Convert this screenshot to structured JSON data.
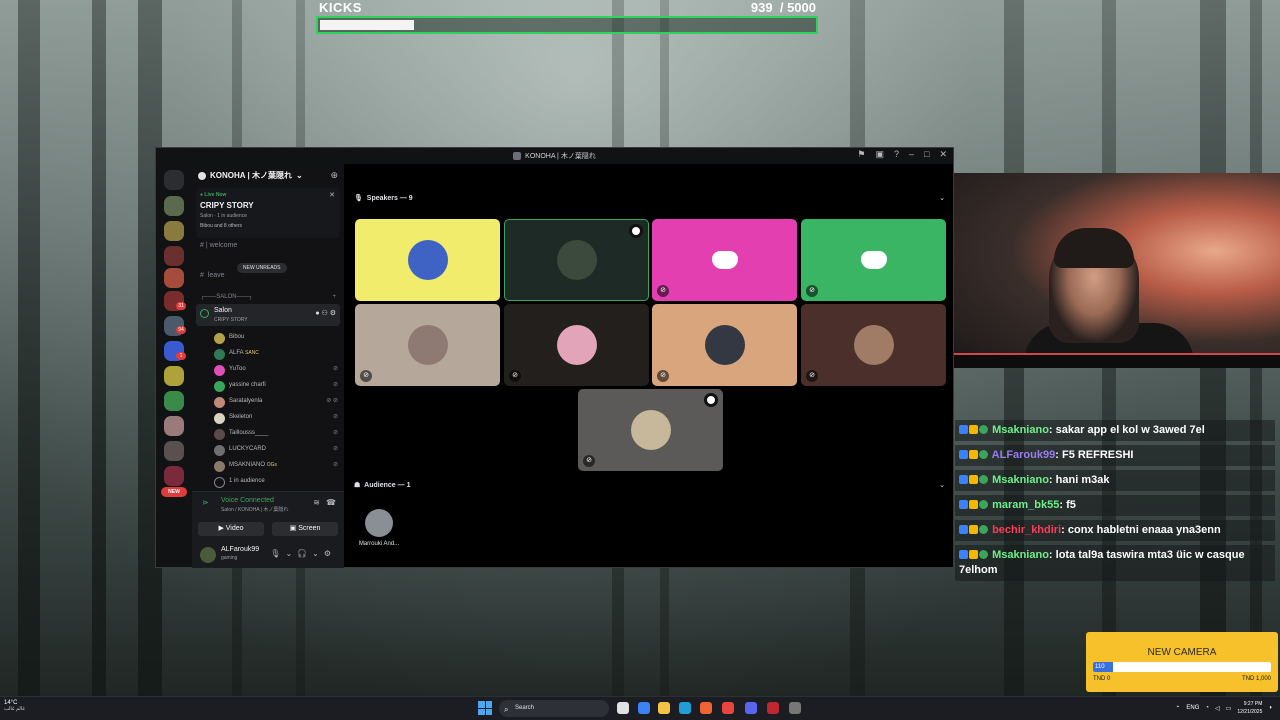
{
  "overlay": {
    "kicks_label": "KICKS",
    "kicks_count": "939",
    "kicks_goal": "/ 5000",
    "kicks_progress": 0.188
  },
  "discord": {
    "window_title": "KONOHA | 木ノ葉隠れ",
    "guild_name": "KONOHA | 木ノ葉隠れ",
    "live": {
      "badge": "Live Now",
      "stage_title": "CRIPY STORY",
      "subtitle": "Salon · 1 in audience",
      "participants": "Bibou and 8 others"
    },
    "channels": [
      "welcome",
      "leave"
    ],
    "new_unreads": "NEW UNREADS",
    "category": "SALON",
    "active_channel": {
      "name": "Salon",
      "topic": "CRIPY STORY"
    },
    "voice_users": [
      {
        "name": "Bibou",
        "color": "#b3a24a"
      },
      {
        "name": "ALFA",
        "tag": "SANC",
        "color": "#2f7a55"
      },
      {
        "name": "YuToo",
        "color": "#e04fb8"
      },
      {
        "name": "yassine charfi",
        "color": "#3ba55c"
      },
      {
        "name": "Saratalyenla",
        "color": "#c08a7a"
      },
      {
        "name": "Skeleton",
        "color": "#d8d3c2"
      },
      {
        "name": "Taillousss____",
        "color": "#5a4a48"
      },
      {
        "name": "LUCKYCARD",
        "color": "#6e6e6e"
      },
      {
        "name": "MSAKNIANO",
        "tag": "OGs",
        "color": "#8a7a6a"
      },
      {
        "name": "1 in audience",
        "color": "#1a1b1e"
      }
    ],
    "voice": {
      "status": "Voice Connected",
      "location": "Salon / KONOHA | 木ノ葉隠れ",
      "video_label": "Video",
      "screen_label": "Screen"
    },
    "user": {
      "name": "ALFarouk99",
      "status": "gaming"
    },
    "speakers_header": "Speakers — 9",
    "audience_header": "Audience — 1",
    "audience": [
      {
        "name": "Marrouki And..."
      }
    ],
    "new_label": "NEW",
    "server_badges": [
      "31",
      "94",
      "1"
    ],
    "tiles": [
      {
        "bg": "#f2ec6c",
        "avatar": "#3f63c5",
        "muted": false,
        "discord": false,
        "badge": false
      },
      {
        "bg": "#1e2a25",
        "avatar": "#3b4a3d",
        "muted": false,
        "discord": false,
        "badge": true
      },
      {
        "bg": "#e43fb1",
        "avatar": "",
        "muted": true,
        "discord": true,
        "badge": false
      },
      {
        "bg": "#3ab564",
        "avatar": "",
        "muted": true,
        "discord": true,
        "badge": false
      },
      {
        "bg": "#b5a89b",
        "avatar": "#8e7a73",
        "muted": true,
        "discord": false,
        "badge": false
      },
      {
        "bg": "#231f1d",
        "avatar": "#e2a4b8",
        "muted": true,
        "discord": false,
        "badge": false
      },
      {
        "bg": "#d9a57c",
        "avatar": "#343842",
        "muted": true,
        "discord": false,
        "badge": false
      },
      {
        "bg": "#4a2f2a",
        "avatar": "#a07b66",
        "muted": true,
        "discord": false,
        "badge": false
      },
      {
        "bg": "#5c5a58",
        "avatar": "#c7b89b",
        "muted": true,
        "discord": false,
        "badge": true
      }
    ]
  },
  "chat": [
    {
      "user": "Msakniano",
      "color": "#6ef08a",
      "text": "sakar app el kol w 3awed 7el"
    },
    {
      "user": "ALFarouk99",
      "color": "#9a7cf0",
      "text": "F5 REFRESHI"
    },
    {
      "user": "Msakniano",
      "color": "#6ef08a",
      "text": "hani m3ak"
    },
    {
      "user": "maram_bk55",
      "color": "#6ef08a",
      "text": "f5"
    },
    {
      "user": "bechir_khdiri",
      "color": "#ff3b58",
      "text": "conx habletni enaaa yna3enn"
    },
    {
      "user": "Msakniano",
      "color": "#6ef08a",
      "text": "lota tal9a taswira mta3 üic w casque 7elhom"
    }
  ],
  "camera_goal": {
    "title": "NEW CAMERA",
    "current": "110",
    "progress": 0.11,
    "min": "TND 0",
    "max": "TND 1,000"
  },
  "taskbar": {
    "temperature": "14°C",
    "weather": "غالم غالب",
    "search_placeholder": "Search",
    "language": "ENG",
    "time": "9:27 PM",
    "date": "12/21/2025"
  }
}
